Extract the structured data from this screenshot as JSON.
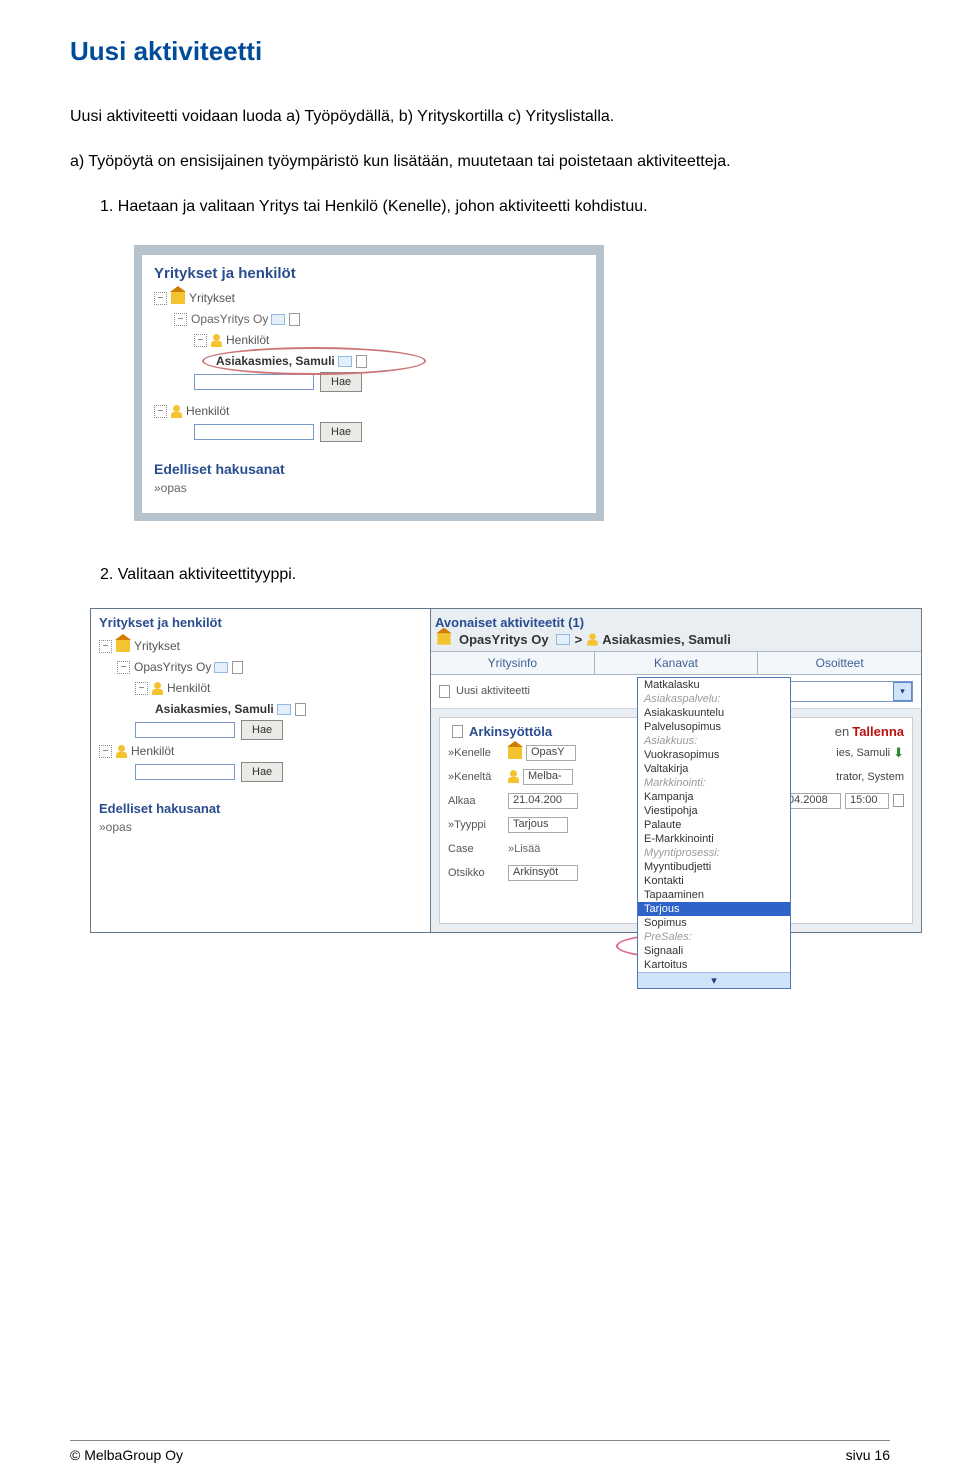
{
  "title": "Uusi aktiviteetti",
  "p_intro": "Uusi aktiviteetti voidaan luoda a) Työpöydällä, b) Yrityskortilla c) Yrityslistalla.",
  "p_desk": "a) Työpöytä on ensisijainen työympäristö kun lisätään, muutetaan tai poistetaan aktiviteetteja.",
  "step1": "1. Haetaan ja valitaan Yritys tai Henkilö (Kenelle), johon aktiviteetti kohdistuu.",
  "step2": "2. Valitaan aktiviteettityyppi.",
  "panel": {
    "heading": "Yritykset ja henkilöt",
    "root_companies": "Yritykset",
    "company": "OpasYritys Oy",
    "people_label": "Henkilöt",
    "selected_person": "Asiakasmies, Samuli",
    "hae": "Hae",
    "root_people": "Henkilöt",
    "history_heading": "Edelliset hakusanat",
    "history_item": "»opas"
  },
  "right": {
    "open_acts": "Avonaiset aktiviteetit (1)",
    "crumb_company": "OpasYritys Oy",
    "crumb_person": "Asiakasmies, Samuli",
    "tabs": [
      "Yritysinfo",
      "Kanavat",
      "Osoitteet"
    ],
    "new_label": "Uusi aktiviteetti",
    "form_title": "Arkinsyöttöla",
    "tallenna": "Tallenna",
    "kenelle": "»Kenelle",
    "kenelle_val": "OpasY",
    "kenelle_suffix": "ies, Samuli",
    "kenelta": "»Keneltä",
    "kenelta_val": "Melba-",
    "kenelta_suffix": "trator, System",
    "alkaa": "Alkaa",
    "alkaa_val": "21.04.200",
    "end_date": "04.2008",
    "end_time": "15:00",
    "tyyppi": "»Tyyppi",
    "tyyppi_val": "Tarjous",
    "case": "Case",
    "case_val": "»Lisää",
    "otsikko": "Otsikko",
    "otsikko_val": "Arkinsyöt"
  },
  "dd": {
    "items": [
      {
        "t": "Matkalasku"
      },
      {
        "t": "Asiakaspalvelu:",
        "h": true
      },
      {
        "t": "Asiakaskuuntelu"
      },
      {
        "t": "Palvelusopimus"
      },
      {
        "t": "Asiakkuus:",
        "h": true
      },
      {
        "t": "Vuokrasopimus"
      },
      {
        "t": "Valtakirja"
      },
      {
        "t": "Markkinointi:",
        "h": true
      },
      {
        "t": "Kampanja"
      },
      {
        "t": "Viestipohja"
      },
      {
        "t": "Palaute"
      },
      {
        "t": "E-Markkinointi"
      },
      {
        "t": "Myyntiprosessi:",
        "h": true
      },
      {
        "t": "Myyntibudjetti"
      },
      {
        "t": "Kontakti"
      },
      {
        "t": "Tapaaminen"
      },
      {
        "t": "Tarjous",
        "sel": true
      },
      {
        "t": "Sopimus"
      },
      {
        "t": "PreSales:",
        "h": true
      },
      {
        "t": "Signaali"
      },
      {
        "t": "Kartoitus"
      }
    ]
  },
  "footer": {
    "left": "© MelbaGroup Oy",
    "right": "sivu 16"
  }
}
